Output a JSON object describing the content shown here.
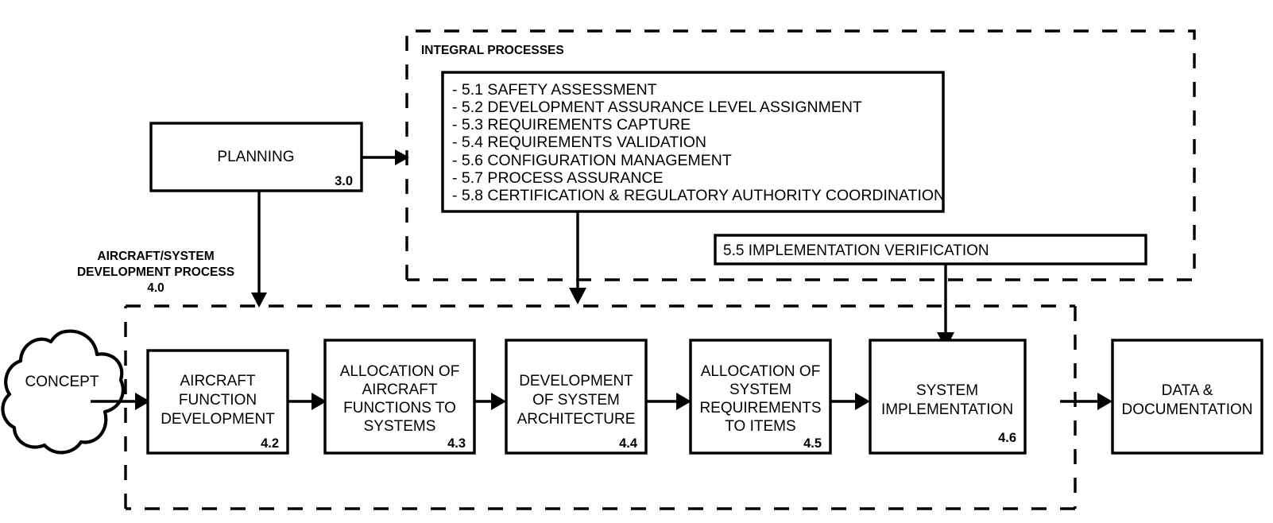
{
  "diagram": {
    "integral_processes": {
      "region_label": "INTEGRAL PROCESSES",
      "items": [
        "- 5.1 SAFETY ASSESSMENT",
        "- 5.2 DEVELOPMENT ASSURANCE LEVEL ASSIGNMENT",
        "- 5.3 REQUIREMENTS CAPTURE",
        "- 5.4 REQUIREMENTS VALIDATION",
        "- 5.6 CONFIGURATION MANAGEMENT",
        "- 5.7 PROCESS ASSURANCE",
        "- 5.8 CERTIFICATION & REGULATORY AUTHORITY COORDINATION"
      ],
      "implementation_verification": "5.5 IMPLEMENTATION VERIFICATION"
    },
    "planning": {
      "label": "PLANNING",
      "number": "3.0"
    },
    "development_region": {
      "label_line1": "AIRCRAFT/SYSTEM",
      "label_line2": "DEVELOPMENT PROCESS",
      "number": "4.0"
    },
    "concept": {
      "label": "CONCEPT"
    },
    "process_steps": [
      {
        "lines": [
          "AIRCRAFT",
          "FUNCTION",
          "DEVELOPMENT"
        ],
        "number": "4.2"
      },
      {
        "lines": [
          "ALLOCATION OF",
          "AIRCRAFT",
          "FUNCTIONS TO",
          "SYSTEMS"
        ],
        "number": "4.3"
      },
      {
        "lines": [
          "DEVELOPMENT",
          "OF SYSTEM",
          "ARCHITECTURE"
        ],
        "number": "4.4"
      },
      {
        "lines": [
          "ALLOCATION OF",
          "SYSTEM",
          "REQUIREMENTS",
          "TO ITEMS"
        ],
        "number": "4.5"
      },
      {
        "lines": [
          "SYSTEM",
          "IMPLEMENTATION"
        ],
        "number": "4.6"
      }
    ],
    "output": {
      "lines": [
        "DATA &",
        "DOCUMENTATION"
      ],
      "number": ""
    },
    "colors": {
      "stroke": "#000000",
      "fill": "#ffffff"
    }
  }
}
